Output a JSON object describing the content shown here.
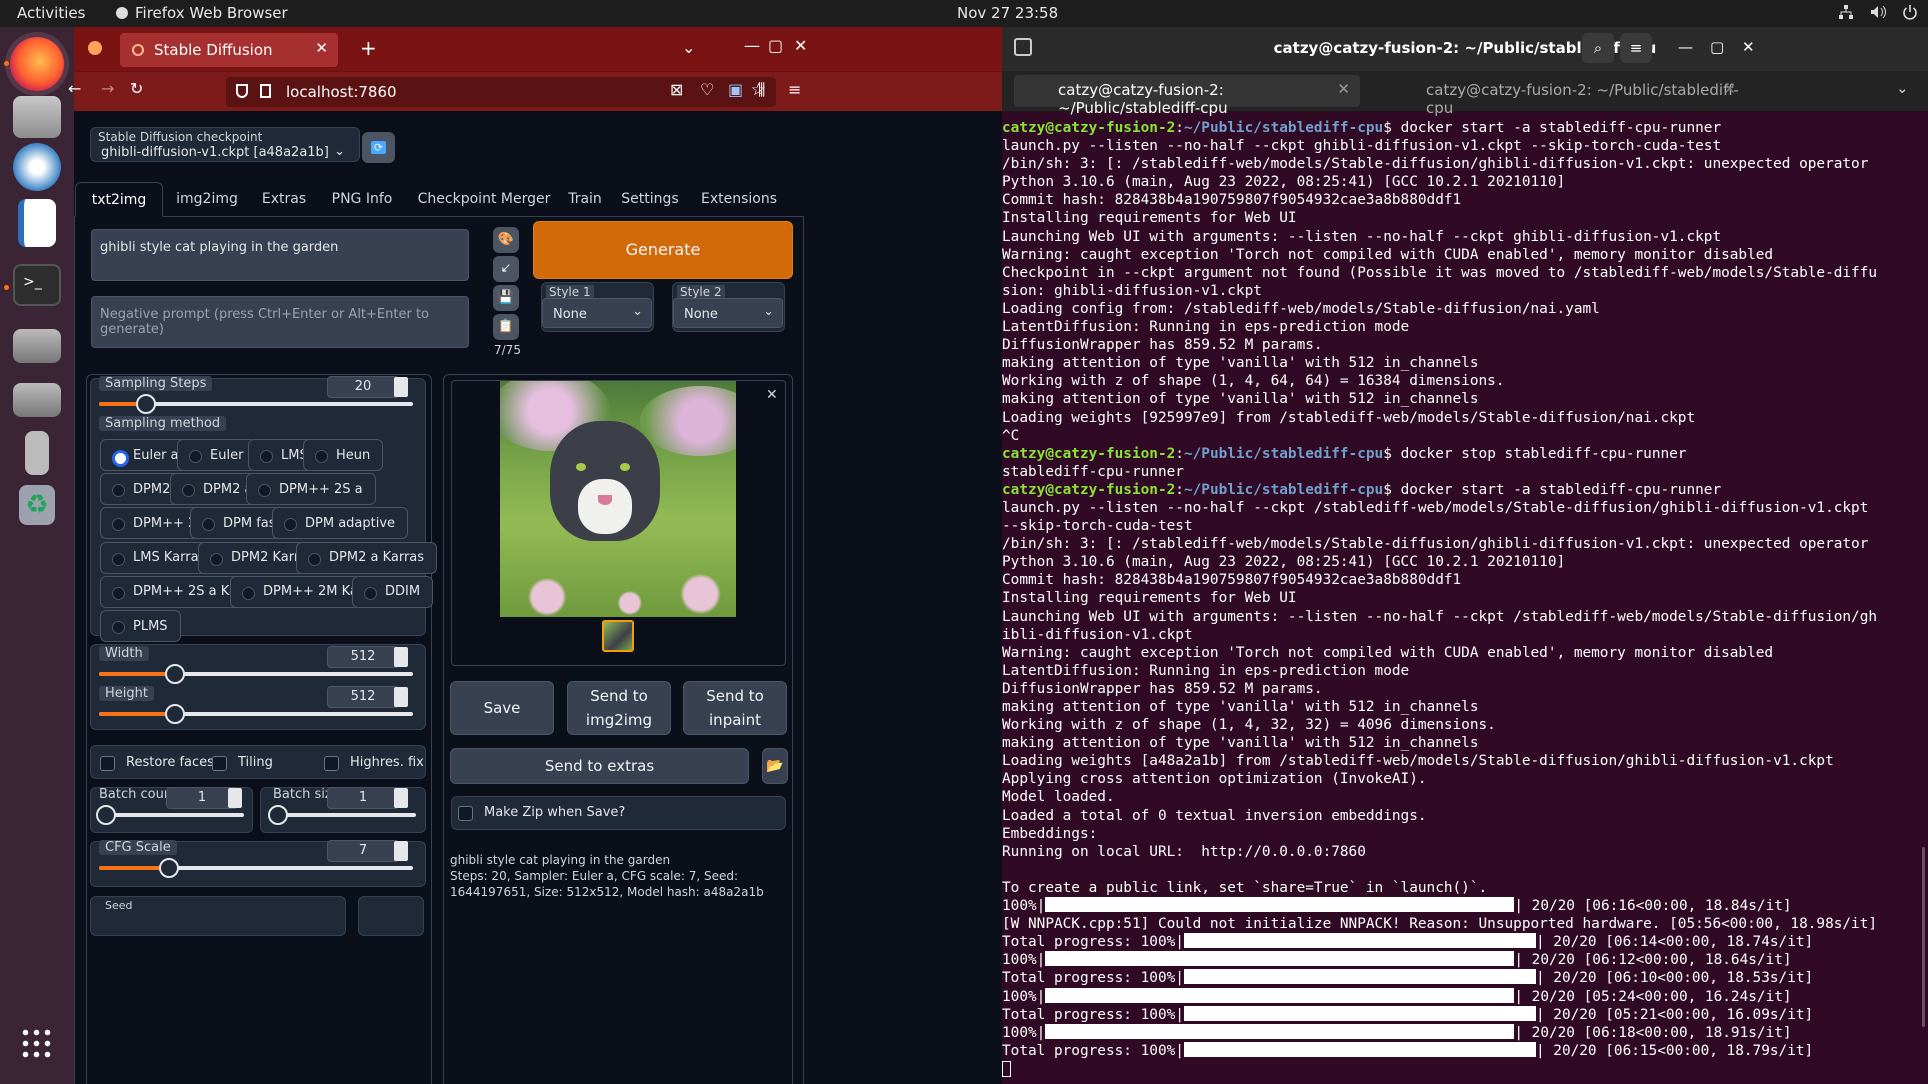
{
  "topbar": {
    "activities": "Activities",
    "app": "Firefox Web Browser",
    "clock": "Nov 27  23:58"
  },
  "dock": {
    "items": [
      "firefox-icon",
      "files-icon",
      "krita-icon",
      "writer-icon",
      "terminal-icon",
      "drive-icon",
      "drive-icon",
      "usb-icon",
      "trash-icon",
      "apps-grid-icon"
    ]
  },
  "browser": {
    "tab_title": "Stable Diffusion",
    "url": "localhost:7860"
  },
  "webui": {
    "checkpoint_label": "Stable Diffusion checkpoint",
    "checkpoint_value": "ghibli-diffusion-v1.ckpt [a48a2a1b]",
    "tabs": [
      "txt2img",
      "img2img",
      "Extras",
      "PNG Info",
      "Checkpoint Merger",
      "Train",
      "Settings",
      "Extensions"
    ],
    "prompt": "ghibli style cat playing in the garden",
    "negative_placeholder": "Negative prompt (press Ctrl+Enter or Alt+Enter to generate)",
    "token_count": "7/75",
    "generate": "Generate",
    "style1_label": "Style 1",
    "style1_value": "None",
    "style2_label": "Style 2",
    "style2_value": "None",
    "sampling_steps_label": "Sampling Steps",
    "sampling_steps": "20",
    "sampling_method_label": "Sampling method",
    "samplers": [
      "Euler a",
      "Euler",
      "LMS",
      "Heun",
      "DPM2",
      "DPM2 a",
      "DPM++ 2S a",
      "DPM++ 2M",
      "DPM fast",
      "DPM adaptive",
      "LMS Karras",
      "DPM2 Karras",
      "DPM2 a Karras",
      "DPM++ 2S a Karras",
      "DPM++ 2M Karras",
      "DDIM",
      "PLMS"
    ],
    "selected_sampler": "Euler a",
    "width_label": "Width",
    "width": "512",
    "height_label": "Height",
    "height": "512",
    "restore_faces": "Restore faces",
    "tiling": "Tiling",
    "highres": "Highres. fix",
    "batch_count_label": "Batch count",
    "batch_count": "1",
    "batch_size_label": "Batch size",
    "batch_size": "1",
    "cfg_label": "CFG Scale",
    "cfg": "7",
    "seed_label": "Seed",
    "save": "Save",
    "send_img2img": "Send to img2img",
    "send_inpaint": "Send to inpaint",
    "send_extras": "Send to extras",
    "make_zip": "Make Zip when Save?",
    "info_prompt": "ghibli style cat playing in the garden",
    "info_params": "Steps: 20, Sampler: Euler a, CFG scale: 7, Seed: 1644197651, Size: 512x512, Model hash: a48a2a1b"
  },
  "terminal": {
    "title": "catzy@catzy-fusion-2: ~/Public/stablediff-cpu",
    "tab1": "catzy@catzy-fusion-2: ~/Public/stablediff-cpu",
    "tab2": "catzy@catzy-fusion-2: ~/Public/stablediff-cpu",
    "prompt_user": "catzy@catzy-fusion-2",
    "prompt_path": "~/Public/stablediff-cpu",
    "lines": [
      {
        "p": true,
        "cmd": "docker start -a stablediff-cpu-runner"
      },
      {
        "t": "launch.py --listen --no-half --ckpt ghibli-diffusion-v1.ckpt --skip-torch-cuda-test"
      },
      {
        "t": "/bin/sh: 3: [: /stablediff-web/models/Stable-diffusion/ghibli-diffusion-v1.ckpt: unexpected operator"
      },
      {
        "t": "Python 3.10.6 (main, Aug 23 2022, 08:25:41) [GCC 10.2.1 20210110]"
      },
      {
        "t": "Commit hash: 828438b4a190759807f9054932cae3a8b880ddf1"
      },
      {
        "t": "Installing requirements for Web UI"
      },
      {
        "t": "Launching Web UI with arguments: --listen --no-half --ckpt ghibli-diffusion-v1.ckpt"
      },
      {
        "t": "Warning: caught exception 'Torch not compiled with CUDA enabled', memory monitor disabled"
      },
      {
        "t": "Checkpoint in --ckpt argument not found (Possible it was moved to /stablediff-web/models/Stable-diffu"
      },
      {
        "t": "sion: ghibli-diffusion-v1.ckpt"
      },
      {
        "t": "Loading config from: /stablediff-web/models/Stable-diffusion/nai.yaml"
      },
      {
        "t": "LatentDiffusion: Running in eps-prediction mode"
      },
      {
        "t": "DiffusionWrapper has 859.52 M params."
      },
      {
        "t": "making attention of type 'vanilla' with 512 in_channels"
      },
      {
        "t": "Working with z of shape (1, 4, 64, 64) = 16384 dimensions."
      },
      {
        "t": "making attention of type 'vanilla' with 512 in_channels"
      },
      {
        "t": "Loading weights [925997e9] from /stablediff-web/models/Stable-diffusion/nai.ckpt"
      },
      {
        "t": "^C"
      },
      {
        "p": true,
        "cmd": "docker stop stablediff-cpu-runner"
      },
      {
        "t": "stablediff-cpu-runner"
      },
      {
        "p": true,
        "cmd": "docker start -a stablediff-cpu-runner"
      },
      {
        "t": "launch.py --listen --no-half --ckpt /stablediff-web/models/Stable-diffusion/ghibli-diffusion-v1.ckpt"
      },
      {
        "t": "--skip-torch-cuda-test"
      },
      {
        "t": "/bin/sh: 3: [: /stablediff-web/models/Stable-diffusion/ghibli-diffusion-v1.ckpt: unexpected operator"
      },
      {
        "t": "Python 3.10.6 (main, Aug 23 2022, 08:25:41) [GCC 10.2.1 20210110]"
      },
      {
        "t": "Commit hash: 828438b4a190759807f9054932cae3a8b880ddf1"
      },
      {
        "t": "Installing requirements for Web UI"
      },
      {
        "t": "Launching Web UI with arguments: --listen --no-half --ckpt /stablediff-web/models/Stable-diffusion/gh"
      },
      {
        "t": "ibli-diffusion-v1.ckpt"
      },
      {
        "t": "Warning: caught exception 'Torch not compiled with CUDA enabled', memory monitor disabled"
      },
      {
        "t": "LatentDiffusion: Running in eps-prediction mode"
      },
      {
        "t": "DiffusionWrapper has 859.52 M params."
      },
      {
        "t": "making attention of type 'vanilla' with 512 in_channels"
      },
      {
        "t": "Working with z of shape (1, 4, 32, 32) = 4096 dimensions."
      },
      {
        "t": "making attention of type 'vanilla' with 512 in_channels"
      },
      {
        "t": "Loading weights [a48a2a1b] from /stablediff-web/models/Stable-diffusion/ghibli-diffusion-v1.ckpt"
      },
      {
        "t": "Applying cross attention optimization (InvokeAI)."
      },
      {
        "t": "Model loaded."
      },
      {
        "t": "Loaded a total of 0 textual inversion embeddings."
      },
      {
        "t": "Embeddings:"
      },
      {
        "t": "Running on local URL:  http://0.0.0.0:7860"
      },
      {
        "t": ""
      },
      {
        "t": "To create a public link, set `share=True` in `launch()`."
      },
      {
        "a": "100%|",
        "bar": 1,
        "b": "| 20/20 [06:16<00:00, 18.84s/it]"
      },
      {
        "t": "[W NNPACK.cpp:51] Could not initialize NNPACK! Reason: Unsupported hardware. [05:56<00:00, 18.98s/it]"
      },
      {
        "a": "Total progress: 100%|",
        "bar": 2,
        "b": "| 20/20 [06:14<00:00, 18.74s/it]"
      },
      {
        "a": "100%|",
        "bar": 1,
        "b": "| 20/20 [06:12<00:00, 18.64s/it]"
      },
      {
        "a": "Total progress: 100%|",
        "bar": 2,
        "b": "| 20/20 [06:10<00:00, 18.53s/it]"
      },
      {
        "a": "100%|",
        "bar": 1,
        "b": "| 20/20 [05:24<00:00, 16.24s/it]"
      },
      {
        "a": "Total progress: 100%|",
        "bar": 2,
        "b": "| 20/20 [05:21<00:00, 16.09s/it]"
      },
      {
        "a": "100%|",
        "bar": 1,
        "b": "| 20/20 [06:18<00:00, 18.91s/it]"
      },
      {
        "a": "Total progress: 100%|",
        "bar": 2,
        "b": "| 20/20 [06:15<00:00, 18.79s/it]"
      }
    ]
  }
}
